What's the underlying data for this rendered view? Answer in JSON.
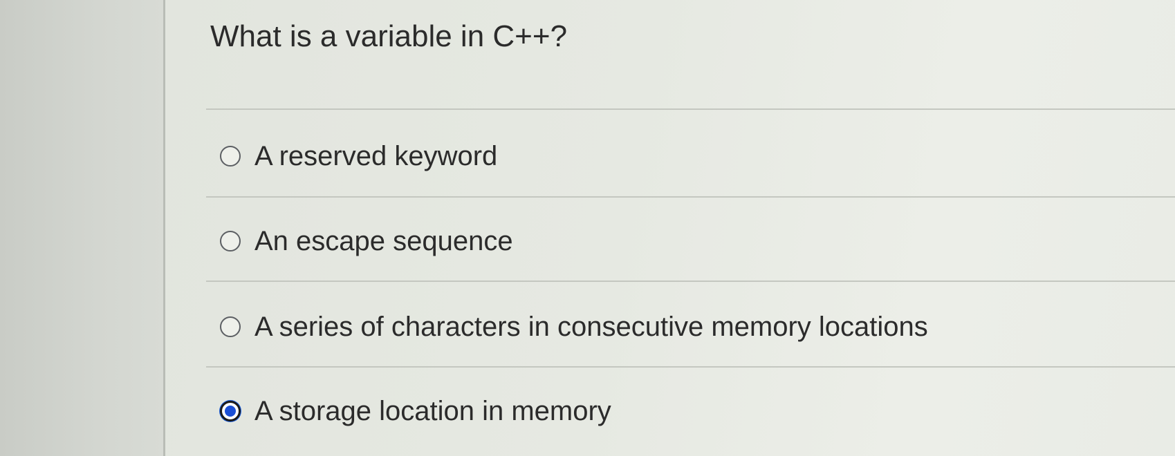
{
  "question": {
    "text": "What is a variable in C++?"
  },
  "answers": [
    {
      "label": "A reserved keyword",
      "selected": false
    },
    {
      "label": "An escape sequence",
      "selected": false
    },
    {
      "label": "A series of characters in consecutive memory locations",
      "selected": false
    },
    {
      "label": "A storage location in memory",
      "selected": true
    }
  ],
  "colors": {
    "selected_radio": "#1a4fd6",
    "text": "#2b2b2b"
  }
}
